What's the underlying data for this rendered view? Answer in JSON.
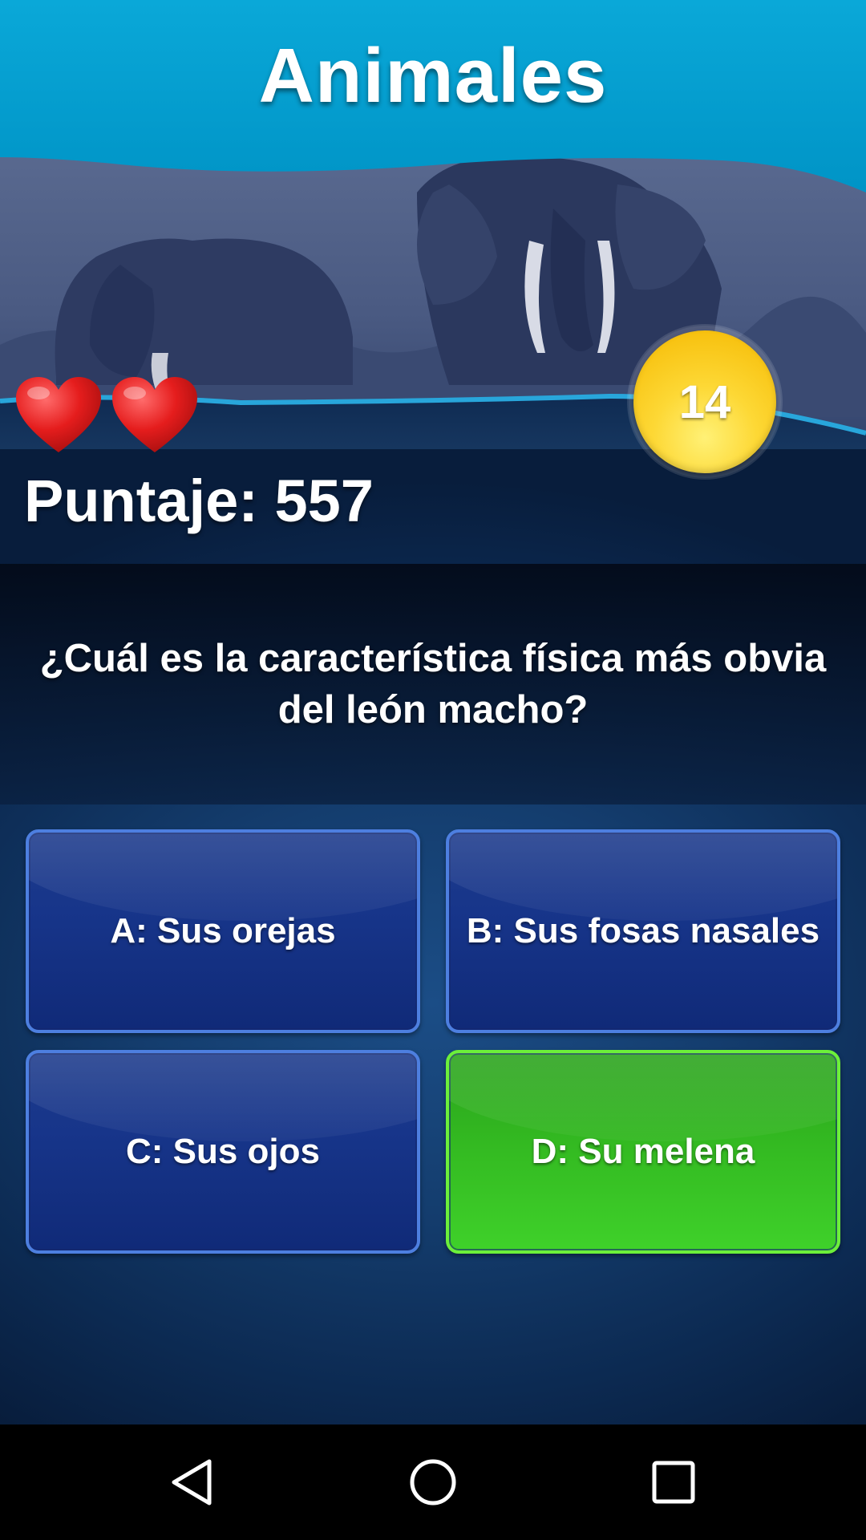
{
  "header": {
    "title": "Animales"
  },
  "status": {
    "lives": 2,
    "timer": "14",
    "score": "Puntaje: 557"
  },
  "question": {
    "text": "¿Cuál es la característica física más obvia del león macho?"
  },
  "answers": [
    {
      "label": "A: Sus orejas",
      "state": "default"
    },
    {
      "label": "B: Sus fosas nasales",
      "state": "default"
    },
    {
      "label": "C: Sus ojos",
      "state": "default"
    },
    {
      "label": "D: Su melena",
      "state": "correct"
    }
  ],
  "colors": {
    "header_blue": "#0aa6d6",
    "answer_blue": "#17358a",
    "answer_correct": "#33b921",
    "timer_yellow": "#fdd835",
    "heart_red": "#e51d1d"
  },
  "icons": {
    "lives": "heart-icon",
    "nav": [
      "back-triangle-icon",
      "home-circle-icon",
      "recents-square-icon"
    ]
  }
}
